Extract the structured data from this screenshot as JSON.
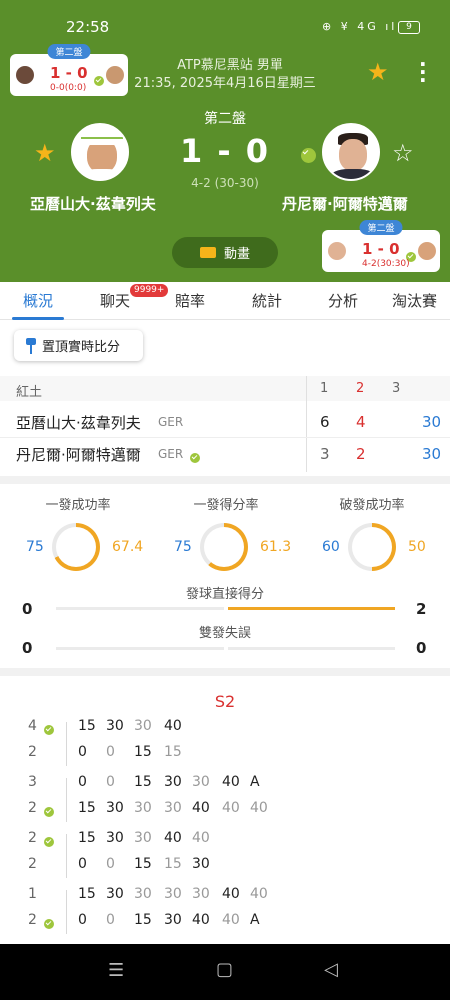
{
  "status": {
    "time": "22:58",
    "icons": "⊕ ¥ 4G ıl",
    "battery": "9"
  },
  "mini_top": {
    "tag": "第二盤",
    "score": "1 - 0",
    "sub": "0-0(0:0)"
  },
  "match": {
    "tournament": "ATP慕尼黑站 男單",
    "datetime": "21:35, 2025年4月16日星期三",
    "set_label": "第二盤",
    "score": "1 - 0",
    "game_score": "4-2 (30-30)",
    "player1": "亞曆山大·茲韋列夫",
    "player2": "丹尼爾·阿爾特邁爾",
    "anim_label": "動畫"
  },
  "mini_bottom": {
    "tag": "第二盤",
    "score": "1 - 0",
    "sub": "4-2(30:30)"
  },
  "tabs": [
    {
      "label": "概況"
    },
    {
      "label": "聊天",
      "badge": "9999+"
    },
    {
      "label": "賠率"
    },
    {
      "label": "統計"
    },
    {
      "label": "分析"
    },
    {
      "label": "淘汰賽"
    }
  ],
  "pin_label": "置頂實時比分",
  "scoreboard": {
    "surface": "紅土",
    "cols": [
      "1",
      "2",
      "3"
    ],
    "rows": [
      {
        "name": "亞曆山大·茲韋列夫",
        "country": "GER",
        "s1": "6",
        "s2": "4",
        "pts": "30"
      },
      {
        "name": "丹尼爾·阿爾特邁爾",
        "country": "GER",
        "s1": "3",
        "s2": "2",
        "pts": "30"
      }
    ]
  },
  "stats": {
    "rings": [
      {
        "label": "一發成功率",
        "left": "75",
        "right": "67.4"
      },
      {
        "label": "一發得分率",
        "left": "75",
        "right": "61.3"
      },
      {
        "label": "破發成功率",
        "left": "60",
        "right": "50"
      }
    ],
    "bars": [
      {
        "label": "發球直接得分",
        "left": "0",
        "right": "2"
      },
      {
        "label": "雙發失誤",
        "left": "0",
        "right": "0"
      }
    ],
    "colors": {
      "player1": "#2a7ad3",
      "player2": "#f0a623"
    }
  },
  "pbp": {
    "set_label": "S2",
    "games": [
      {
        "a": "4",
        "b": "2",
        "server": "a",
        "top": [
          "15",
          "30",
          "30",
          "40"
        ],
        "bot": [
          "0",
          "0",
          "15",
          "15"
        ]
      },
      {
        "a": "3",
        "b": "2",
        "server": "b",
        "top": [
          "0",
          "0",
          "15",
          "30",
          "30",
          "40",
          "A"
        ],
        "bot": [
          "15",
          "30",
          "30",
          "30",
          "40",
          "40",
          "40"
        ]
      },
      {
        "a": "2",
        "b": "2",
        "server": "a",
        "top": [
          "15",
          "30",
          "30",
          "40",
          "40"
        ],
        "bot": [
          "0",
          "0",
          "15",
          "15",
          "30"
        ]
      },
      {
        "a": "1",
        "b": "2",
        "server": "b",
        "top": [
          "15",
          "30",
          "30",
          "30",
          "30",
          "40",
          "40"
        ],
        "bot": [
          "0",
          "0",
          "15",
          "30",
          "40",
          "40",
          "A"
        ]
      }
    ]
  },
  "nav": {
    "menu": "☰",
    "home": "▢",
    "back": "◁"
  }
}
